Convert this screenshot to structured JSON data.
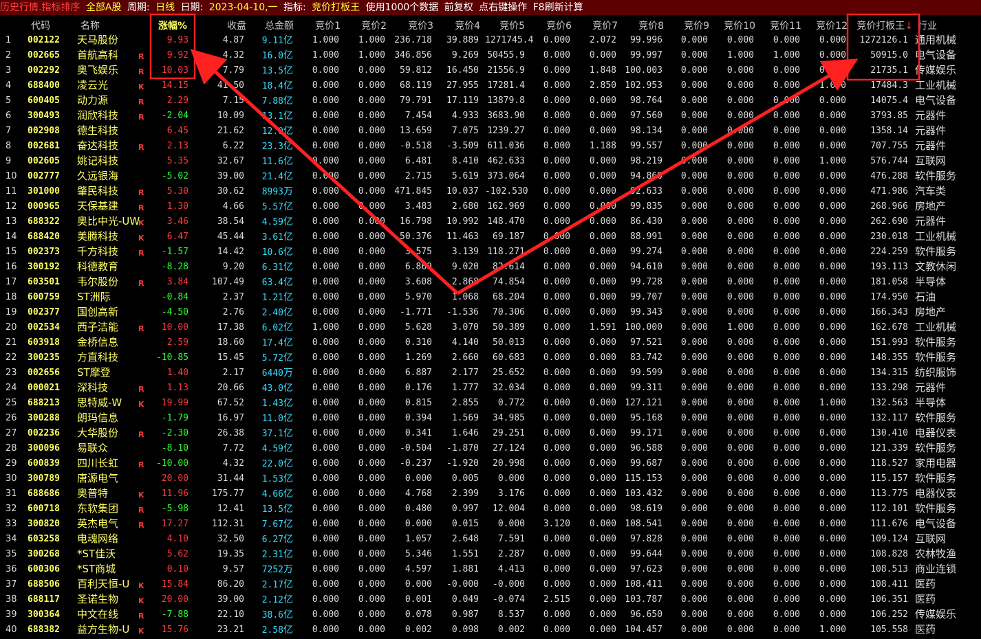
{
  "titlebar": {
    "breadcrumb": "历史行情.指标排序",
    "scope": "全部A股",
    "period_label": "周期:",
    "period_value": "日线",
    "date_label": "日期:",
    "date_value": "2023-04-10,一",
    "indicator_label": "指标:",
    "indicator_value": "竞价打板王",
    "data_note": "使用1000个数据",
    "adjust": "前复权",
    "hint": "点右键操作",
    "refresh": "F8刷新计算"
  },
  "columns": [
    "代码",
    "名称",
    "涨幅%",
    "收盘",
    "总金额",
    "竞价1",
    "竞价2",
    "竞价3",
    "竞价4",
    "竞价5",
    "竞价6",
    "竞价7",
    "竞价8",
    "竞价9",
    "竞价10",
    "竞价11",
    "竞价12",
    "竞价打板王",
    "行业"
  ],
  "sort_indicator": "↓",
  "colors": {
    "up": "#ff3b3b",
    "down": "#33ff33",
    "flag_r": "#ff3b3b",
    "annotation": "#ff2020"
  },
  "rows": [
    {
      "idx": "1",
      "code": "002122",
      "name": "天马股份",
      "flag": "",
      "chg": "9.93",
      "close": "4.87",
      "amt": "9.11",
      "unit": "亿",
      "j": [
        "1.000",
        "1.000",
        "236.718",
        "39.889",
        "1271745.4",
        "0.000",
        "2.072",
        "99.996",
        "0.000",
        "0.000",
        "0.000",
        "0.000"
      ],
      "king": "1272126.1",
      "industry": "通用机械"
    },
    {
      "idx": "2",
      "code": "002665",
      "name": "首航高科",
      "flag": "R",
      "chg": "9.92",
      "close": "4.32",
      "amt": "16.0",
      "unit": "亿",
      "j": [
        "1.000",
        "1.000",
        "346.856",
        "9.269",
        "50455.9",
        "0.000",
        "0.000",
        "99.997",
        "0.000",
        "1.000",
        "1.000",
        "0.000"
      ],
      "king": "50915.0",
      "industry": "电气设备"
    },
    {
      "idx": "3",
      "code": "002292",
      "name": "奥飞娱乐",
      "flag": "R",
      "chg": "10.03",
      "close": "7.79",
      "amt": "13.5",
      "unit": "亿",
      "j": [
        "0.000",
        "0.000",
        "59.812",
        "16.450",
        "21556.9",
        "0.000",
        "1.848",
        "100.003",
        "0.000",
        "0.000",
        "0.000",
        "0.000"
      ],
      "king": "21735.1",
      "industry": "传媒娱乐"
    },
    {
      "idx": "4",
      "code": "688400",
      "name": "凌云光",
      "flag": "K",
      "chg": "14.15",
      "close": "41.50",
      "amt": "18.4",
      "unit": "亿",
      "j": [
        "0.000",
        "0.000",
        "68.119",
        "27.955",
        "17281.4",
        "0.000",
        "2.850",
        "102.953",
        "0.000",
        "0.000",
        "0.000",
        "1.000"
      ],
      "king": "17484.3",
      "industry": "工业机械"
    },
    {
      "idx": "5",
      "code": "600405",
      "name": "动力源",
      "flag": "R",
      "chg": "2.29",
      "close": "7.15",
      "amt": "7.88",
      "unit": "亿",
      "j": [
        "0.000",
        "0.000",
        "79.791",
        "17.119",
        "13879.8",
        "0.000",
        "0.000",
        "98.764",
        "0.000",
        "0.000",
        "0.000",
        "0.000"
      ],
      "king": "14075.4",
      "industry": "电气设备"
    },
    {
      "idx": "6",
      "code": "300493",
      "name": "润欣科技",
      "flag": "R",
      "chg": "-2.04",
      "close": "10.09",
      "amt": "13.1",
      "unit": "亿",
      "j": [
        "0.000",
        "0.000",
        "7.454",
        "4.933",
        "3683.90",
        "0.000",
        "0.000",
        "97.560",
        "0.000",
        "0.000",
        "0.000",
        "0.000"
      ],
      "king": "3793.85",
      "industry": "元器件"
    },
    {
      "idx": "7",
      "code": "002908",
      "name": "德生科技",
      "flag": "",
      "chg": "6.45",
      "close": "21.62",
      "amt": "12.0",
      "unit": "亿",
      "j": [
        "0.000",
        "0.000",
        "13.659",
        "7.075",
        "1239.27",
        "0.000",
        "0.000",
        "98.134",
        "0.000",
        "0.000",
        "0.000",
        "0.000"
      ],
      "king": "1358.14",
      "industry": "元器件"
    },
    {
      "idx": "8",
      "code": "002681",
      "name": "奋达科技",
      "flag": "R",
      "chg": "2.13",
      "close": "6.22",
      "amt": "23.3",
      "unit": "亿",
      "j": [
        "0.000",
        "0.000",
        "-0.518",
        "-3.509",
        "611.036",
        "0.000",
        "1.188",
        "99.557",
        "0.000",
        "0.000",
        "0.000",
        "0.000"
      ],
      "king": "707.755",
      "industry": "元器件"
    },
    {
      "idx": "9",
      "code": "002605",
      "name": "姚记科技",
      "flag": "",
      "chg": "5.35",
      "close": "32.67",
      "amt": "11.6",
      "unit": "亿",
      "j": [
        "0.000",
        "0.000",
        "6.481",
        "8.410",
        "462.633",
        "0.000",
        "0.000",
        "98.219",
        "0.000",
        "0.000",
        "0.000",
        "1.000"
      ],
      "king": "576.744",
      "industry": "互联网"
    },
    {
      "idx": "10",
      "code": "002777",
      "name": "久远银海",
      "flag": "",
      "chg": "-5.02",
      "close": "39.00",
      "amt": "21.4",
      "unit": "亿",
      "j": [
        "0.000",
        "0.000",
        "2.715",
        "5.619",
        "373.064",
        "0.000",
        "0.000",
        "94.860",
        "0.000",
        "0.000",
        "0.000",
        "0.000"
      ],
      "king": "476.288",
      "industry": "软件服务"
    },
    {
      "idx": "11",
      "code": "301000",
      "name": "肇民科技",
      "flag": "R",
      "chg": "5.30",
      "close": "30.62",
      "amt": "8993",
      "unit": "万",
      "j": [
        "0.000",
        "0.000",
        "471.845",
        "10.037",
        "-102.530",
        "0.000",
        "0.000",
        "92.633",
        "0.000",
        "0.000",
        "0.000",
        "0.000"
      ],
      "king": "471.986",
      "industry": "汽车类"
    },
    {
      "idx": "12",
      "code": "000965",
      "name": "天保基建",
      "flag": "R",
      "chg": "1.30",
      "close": "4.66",
      "amt": "5.57",
      "unit": "亿",
      "j": [
        "0.000",
        "0.000",
        "3.483",
        "2.680",
        "162.969",
        "0.000",
        "0.000",
        "99.835",
        "0.000",
        "0.000",
        "0.000",
        "0.000"
      ],
      "king": "268.966",
      "industry": "房地产"
    },
    {
      "idx": "13",
      "code": "688322",
      "name": "奥比中光-UW",
      "flag": "K",
      "chg": "3.46",
      "close": "38.54",
      "amt": "4.59",
      "unit": "亿",
      "j": [
        "0.000",
        "0.000",
        "16.798",
        "10.992",
        "148.470",
        "0.000",
        "0.000",
        "86.430",
        "0.000",
        "0.000",
        "0.000",
        "0.000"
      ],
      "king": "262.690",
      "industry": "元器件"
    },
    {
      "idx": "14",
      "code": "688420",
      "name": "美腾科技",
      "flag": "K",
      "chg": "6.47",
      "close": "45.44",
      "amt": "3.61",
      "unit": "亿",
      "j": [
        "0.000",
        "0.000",
        "50.376",
        "11.463",
        "69.187",
        "0.000",
        "0.000",
        "88.991",
        "0.000",
        "0.000",
        "0.000",
        "0.000"
      ],
      "king": "230.018",
      "industry": "工业机械"
    },
    {
      "idx": "15",
      "code": "002373",
      "name": "千方科技",
      "flag": "R",
      "chg": "-1.57",
      "close": "14.42",
      "amt": "10.6",
      "unit": "亿",
      "j": [
        "0.000",
        "0.000",
        "3.575",
        "3.139",
        "118.271",
        "0.000",
        "0.000",
        "99.274",
        "0.000",
        "0.000",
        "0.000",
        "0.000"
      ],
      "king": "224.259",
      "industry": "软件服务"
    },
    {
      "idx": "16",
      "code": "300192",
      "name": "科德教育",
      "flag": "",
      "chg": "-8.28",
      "close": "9.20",
      "amt": "6.31",
      "unit": "亿",
      "j": [
        "0.000",
        "0.000",
        "6.869",
        "9.020",
        "82.614",
        "0.000",
        "0.000",
        "94.610",
        "0.000",
        "0.000",
        "0.000",
        "0.000"
      ],
      "king": "193.113",
      "industry": "文教休闲"
    },
    {
      "idx": "17",
      "code": "603501",
      "name": "韦尔股份",
      "flag": "R",
      "chg": "3.84",
      "close": "107.49",
      "amt": "63.4",
      "unit": "亿",
      "j": [
        "0.000",
        "0.000",
        "3.608",
        "2.868",
        "74.854",
        "0.000",
        "0.000",
        "99.728",
        "0.000",
        "0.000",
        "0.000",
        "0.000"
      ],
      "king": "181.058",
      "industry": "半导体"
    },
    {
      "idx": "18",
      "code": "600759",
      "name": "ST洲际",
      "flag": "",
      "chg": "-0.84",
      "close": "2.37",
      "amt": "1.21",
      "unit": "亿",
      "j": [
        "0.000",
        "0.000",
        "5.970",
        "1.068",
        "68.204",
        "0.000",
        "0.000",
        "99.707",
        "0.000",
        "0.000",
        "0.000",
        "0.000"
      ],
      "king": "174.950",
      "industry": "石油"
    },
    {
      "idx": "19",
      "code": "002377",
      "name": "国创高新",
      "flag": "",
      "chg": "-4.50",
      "close": "2.76",
      "amt": "2.40",
      "unit": "亿",
      "j": [
        "0.000",
        "0.000",
        "-1.771",
        "-1.536",
        "70.306",
        "0.000",
        "0.000",
        "99.343",
        "0.000",
        "0.000",
        "0.000",
        "0.000"
      ],
      "king": "166.343",
      "industry": "房地产"
    },
    {
      "idx": "20",
      "code": "002534",
      "name": "西子洁能",
      "flag": "R",
      "chg": "10.00",
      "close": "17.38",
      "amt": "6.02",
      "unit": "亿",
      "j": [
        "1.000",
        "0.000",
        "5.628",
        "3.070",
        "50.389",
        "0.000",
        "1.591",
        "100.000",
        "0.000",
        "1.000",
        "0.000",
        "0.000"
      ],
      "king": "162.678",
      "industry": "工业机械"
    },
    {
      "idx": "21",
      "code": "603918",
      "name": "金桥信息",
      "flag": "",
      "chg": "2.59",
      "close": "18.60",
      "amt": "17.4",
      "unit": "亿",
      "j": [
        "0.000",
        "0.000",
        "0.310",
        "4.140",
        "50.013",
        "0.000",
        "0.000",
        "97.521",
        "0.000",
        "0.000",
        "0.000",
        "0.000"
      ],
      "king": "151.993",
      "industry": "软件服务"
    },
    {
      "idx": "22",
      "code": "300235",
      "name": "方直科技",
      "flag": "",
      "chg": "-10.85",
      "close": "15.45",
      "amt": "5.72",
      "unit": "亿",
      "j": [
        "0.000",
        "0.000",
        "1.269",
        "2.660",
        "60.683",
        "0.000",
        "0.000",
        "83.742",
        "0.000",
        "0.000",
        "0.000",
        "0.000"
      ],
      "king": "148.355",
      "industry": "软件服务"
    },
    {
      "idx": "23",
      "code": "002656",
      "name": "ST摩登",
      "flag": "",
      "chg": "1.40",
      "close": "2.17",
      "amt": "6440",
      "unit": "万",
      "j": [
        "0.000",
        "0.000",
        "6.887",
        "2.177",
        "25.652",
        "0.000",
        "0.000",
        "99.599",
        "0.000",
        "0.000",
        "0.000",
        "0.000"
      ],
      "king": "134.315",
      "industry": "纺织服饰"
    },
    {
      "idx": "24",
      "code": "000021",
      "name": "深科技",
      "flag": "R",
      "chg": "1.13",
      "close": "20.66",
      "amt": "43.0",
      "unit": "亿",
      "j": [
        "0.000",
        "0.000",
        "0.176",
        "1.777",
        "32.034",
        "0.000",
        "0.000",
        "99.311",
        "0.000",
        "0.000",
        "0.000",
        "0.000"
      ],
      "king": "133.298",
      "industry": "元器件"
    },
    {
      "idx": "25",
      "code": "688213",
      "name": "思特威-W",
      "flag": "K",
      "chg": "19.99",
      "close": "67.52",
      "amt": "1.43",
      "unit": "亿",
      "j": [
        "0.000",
        "0.000",
        "0.815",
        "2.855",
        "0.772",
        "0.000",
        "0.000",
        "127.121",
        "0.000",
        "0.000",
        "0.000",
        "1.000"
      ],
      "king": "132.563",
      "industry": "半导体"
    },
    {
      "idx": "26",
      "code": "300288",
      "name": "朗玛信息",
      "flag": "",
      "chg": "-1.79",
      "close": "16.97",
      "amt": "11.0",
      "unit": "亿",
      "j": [
        "0.000",
        "0.000",
        "0.394",
        "1.569",
        "34.985",
        "0.000",
        "0.000",
        "95.168",
        "0.000",
        "0.000",
        "0.000",
        "0.000"
      ],
      "king": "132.117",
      "industry": "软件服务"
    },
    {
      "idx": "27",
      "code": "002236",
      "name": "大华股份",
      "flag": "R",
      "chg": "-2.30",
      "close": "26.38",
      "amt": "37.1",
      "unit": "亿",
      "j": [
        "0.000",
        "0.000",
        "0.341",
        "1.646",
        "29.251",
        "0.000",
        "0.000",
        "99.171",
        "0.000",
        "0.000",
        "0.000",
        "0.000"
      ],
      "king": "130.410",
      "industry": "电器仪表"
    },
    {
      "idx": "28",
      "code": "300096",
      "name": "易联众",
      "flag": "",
      "chg": "-8.10",
      "close": "7.72",
      "amt": "4.59",
      "unit": "亿",
      "j": [
        "0.000",
        "0.000",
        "-0.504",
        "-1.870",
        "27.124",
        "0.000",
        "0.000",
        "96.588",
        "0.000",
        "0.000",
        "0.000",
        "0.000"
      ],
      "king": "121.339",
      "industry": "软件服务"
    },
    {
      "idx": "29",
      "code": "600839",
      "name": "四川长虹",
      "flag": "R",
      "chg": "-10.00",
      "close": "4.32",
      "amt": "22.0",
      "unit": "亿",
      "j": [
        "0.000",
        "0.000",
        "-0.237",
        "-1.920",
        "20.998",
        "0.000",
        "0.000",
        "99.687",
        "0.000",
        "0.000",
        "0.000",
        "0.000"
      ],
      "king": "118.527",
      "industry": "家用电器"
    },
    {
      "idx": "30",
      "code": "300789",
      "name": "唐源电气",
      "flag": "",
      "chg": "20.00",
      "close": "31.44",
      "amt": "1.53",
      "unit": "亿",
      "j": [
        "0.000",
        "0.000",
        "0.000",
        "0.005",
        "0.000",
        "0.000",
        "0.000",
        "115.153",
        "0.000",
        "0.000",
        "0.000",
        "0.000"
      ],
      "king": "115.157",
      "industry": "软件服务"
    },
    {
      "idx": "31",
      "code": "688686",
      "name": "奥普特",
      "flag": "K",
      "chg": "11.96",
      "close": "175.77",
      "amt": "4.66",
      "unit": "亿",
      "j": [
        "0.000",
        "0.000",
        "4.768",
        "2.399",
        "3.176",
        "0.000",
        "0.000",
        "103.432",
        "0.000",
        "0.000",
        "0.000",
        "0.000"
      ],
      "king": "113.775",
      "industry": "电器仪表"
    },
    {
      "idx": "32",
      "code": "600718",
      "name": "东软集团",
      "flag": "R",
      "chg": "-5.98",
      "close": "12.41",
      "amt": "13.5",
      "unit": "亿",
      "j": [
        "0.000",
        "0.000",
        "0.480",
        "0.997",
        "12.004",
        "0.000",
        "0.000",
        "98.619",
        "0.000",
        "0.000",
        "0.000",
        "0.000"
      ],
      "king": "112.101",
      "industry": "软件服务"
    },
    {
      "idx": "33",
      "code": "300820",
      "name": "英杰电气",
      "flag": "R",
      "chg": "17.27",
      "close": "112.31",
      "amt": "7.67",
      "unit": "亿",
      "j": [
        "0.000",
        "0.000",
        "0.000",
        "0.015",
        "0.000",
        "3.120",
        "0.000",
        "108.541",
        "0.000",
        "0.000",
        "0.000",
        "0.000"
      ],
      "king": "111.676",
      "industry": "电气设备"
    },
    {
      "idx": "34",
      "code": "603258",
      "name": "电魂网络",
      "flag": "",
      "chg": "4.10",
      "close": "32.50",
      "amt": "6.27",
      "unit": "亿",
      "j": [
        "0.000",
        "0.000",
        "1.057",
        "2.648",
        "7.591",
        "0.000",
        "0.000",
        "97.828",
        "0.000",
        "0.000",
        "0.000",
        "0.000"
      ],
      "king": "109.124",
      "industry": "互联网"
    },
    {
      "idx": "35",
      "code": "300268",
      "name": "*ST佳沃",
      "flag": "",
      "chg": "5.62",
      "close": "19.35",
      "amt": "2.31",
      "unit": "亿",
      "j": [
        "0.000",
        "0.000",
        "5.346",
        "1.551",
        "2.287",
        "0.000",
        "0.000",
        "99.644",
        "0.000",
        "0.000",
        "0.000",
        "0.000"
      ],
      "king": "108.828",
      "industry": "农林牧渔"
    },
    {
      "idx": "36",
      "code": "600306",
      "name": "*ST商城",
      "flag": "",
      "chg": "0.10",
      "close": "9.57",
      "amt": "7252",
      "unit": "万",
      "j": [
        "0.000",
        "0.000",
        "4.597",
        "1.881",
        "4.413",
        "0.000",
        "0.000",
        "97.623",
        "0.000",
        "0.000",
        "0.000",
        "0.000"
      ],
      "king": "108.513",
      "industry": "商业连锁"
    },
    {
      "idx": "37",
      "code": "688506",
      "name": "百利天恒-U",
      "flag": "K",
      "chg": "15.84",
      "close": "86.20",
      "amt": "2.17",
      "unit": "亿",
      "j": [
        "0.000",
        "0.000",
        "0.000",
        "-0.000",
        "-0.000",
        "0.000",
        "0.000",
        "108.411",
        "0.000",
        "0.000",
        "0.000",
        "0.000"
      ],
      "king": "108.411",
      "industry": "医药"
    },
    {
      "idx": "38",
      "code": "688117",
      "name": "圣诺生物",
      "flag": "K",
      "chg": "20.00",
      "close": "39.00",
      "amt": "2.12",
      "unit": "亿",
      "j": [
        "0.000",
        "0.000",
        "0.001",
        "0.049",
        "-0.074",
        "2.515",
        "0.000",
        "103.787",
        "0.000",
        "0.000",
        "0.000",
        "0.000"
      ],
      "king": "106.351",
      "industry": "医药"
    },
    {
      "idx": "39",
      "code": "300364",
      "name": "中文在线",
      "flag": "R",
      "chg": "-7.88",
      "close": "22.10",
      "amt": "38.6",
      "unit": "亿",
      "j": [
        "0.000",
        "0.000",
        "0.078",
        "0.987",
        "8.537",
        "0.000",
        "0.000",
        "96.650",
        "0.000",
        "0.000",
        "0.000",
        "0.000"
      ],
      "king": "106.252",
      "industry": "传媒娱乐"
    },
    {
      "idx": "40",
      "code": "688382",
      "name": "益方生物-U",
      "flag": "K",
      "chg": "15.76",
      "close": "23.21",
      "amt": "2.58",
      "unit": "亿",
      "j": [
        "0.000",
        "0.000",
        "0.002",
        "0.098",
        "0.002",
        "0.000",
        "0.000",
        "104.457",
        "0.000",
        "0.000",
        "0.000",
        "1.000"
      ],
      "king": "105.558",
      "industry": "医药"
    }
  ]
}
